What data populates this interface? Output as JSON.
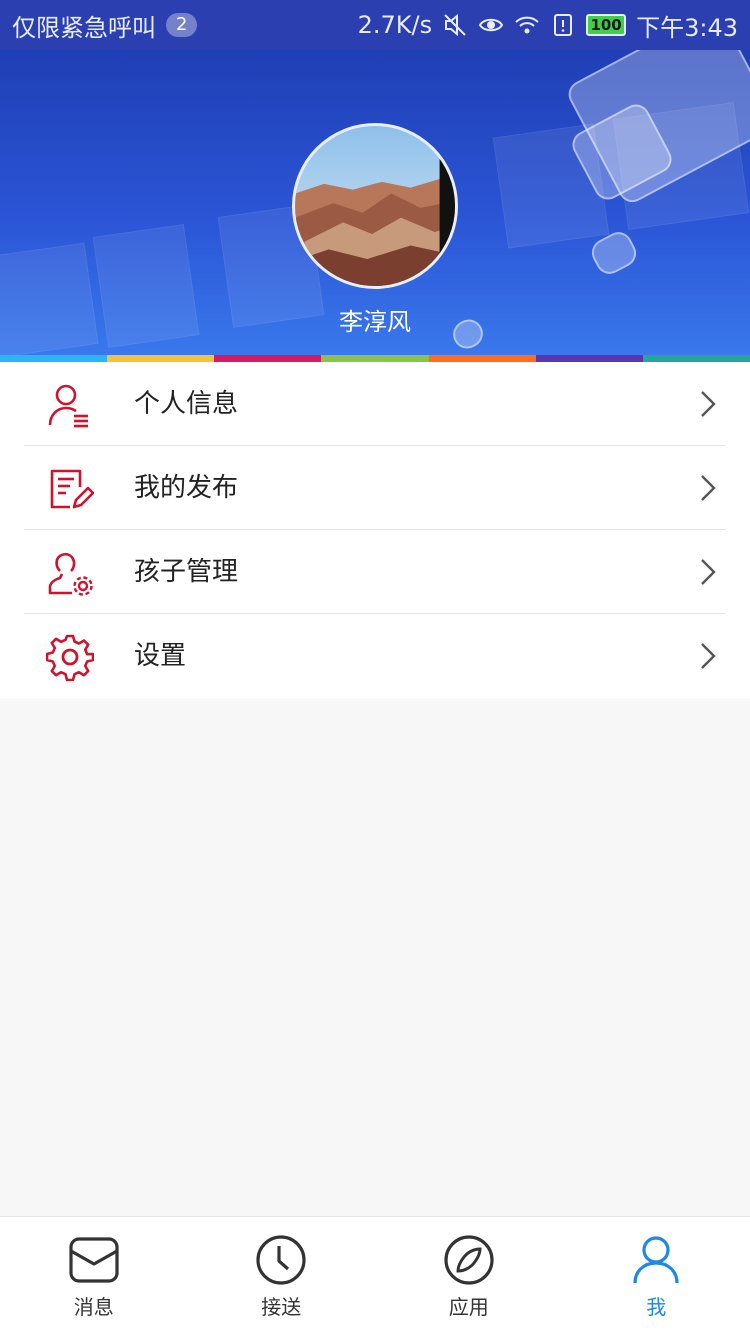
{
  "status_bar": {
    "carrier": "仅限紧急呼叫",
    "badge": "2",
    "net_speed": "2.7K/s",
    "battery": "100",
    "time": "下午3:43"
  },
  "profile": {
    "name": "李淳风"
  },
  "color_strip": [
    "#29b6f6",
    "#f4c23b",
    "#d81b60",
    "#8bc34a",
    "#ff6d1f",
    "#5e35b1",
    "#26a69a"
  ],
  "menu": {
    "items": [
      {
        "label": "个人信息",
        "icon": "user-info-icon"
      },
      {
        "label": "我的发布",
        "icon": "edit-document-icon"
      },
      {
        "label": "孩子管理",
        "icon": "user-settings-icon"
      },
      {
        "label": "设置",
        "icon": "gear-icon"
      }
    ]
  },
  "tabbar": {
    "tabs": [
      {
        "label": "消息",
        "icon": "envelope-icon"
      },
      {
        "label": "接送",
        "icon": "clock-icon"
      },
      {
        "label": "应用",
        "icon": "compass-icon"
      },
      {
        "label": "我",
        "icon": "person-icon",
        "active": true
      }
    ]
  },
  "colors": {
    "accent_red": "#d0122c",
    "accent_blue": "#1e88e5",
    "header_blue": "#2b55d6"
  }
}
